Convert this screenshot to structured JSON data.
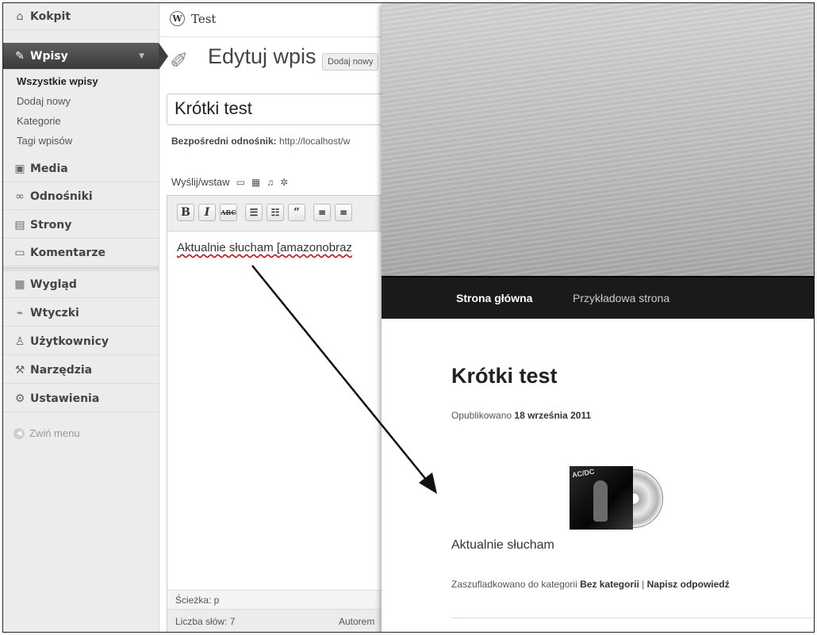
{
  "sidebar": {
    "dashboard": "Kokpit",
    "posts": "Wpisy",
    "posts_sub": [
      "Wszystkie wpisy",
      "Dodaj nowy",
      "Kategorie",
      "Tagi wpisów"
    ],
    "media": "Media",
    "links": "Odnośniki",
    "pages": "Strony",
    "comments": "Komentarze",
    "appearance": "Wygląd",
    "plugins": "Wtyczki",
    "users": "Użytkownicy",
    "tools": "Narzędzia",
    "settings": "Ustawienia",
    "collapse": "Zwiń menu"
  },
  "adminbar": {
    "site_name": "Test"
  },
  "editor": {
    "heading": "Edytuj wpis",
    "add_new": "Dodaj nowy",
    "title_value": "Krótki test",
    "permalink_label": "Bezpośredni odnośnik:",
    "permalink_url": "http://localhost/w",
    "upload_label": "Wyślij/wstaw",
    "content": "Aktualnie słucham [amazonobraz",
    "path": "Ścieżka: p",
    "word_count": "Liczba słów: 7",
    "author": "Autorem"
  },
  "site": {
    "nav": [
      "Strona główna",
      "Przykładowa strona"
    ],
    "post_title": "Krótki test",
    "posted_prefix": "Opublikowano",
    "posted_date": "18 września 2011",
    "album_text": "AC/DC",
    "now_playing": "Aktualnie słucham",
    "filed_prefix": "Zaszufladkowano do kategorii",
    "category": "Bez kategorii",
    "separator": "|",
    "reply": "Napisz odpowiedź"
  }
}
